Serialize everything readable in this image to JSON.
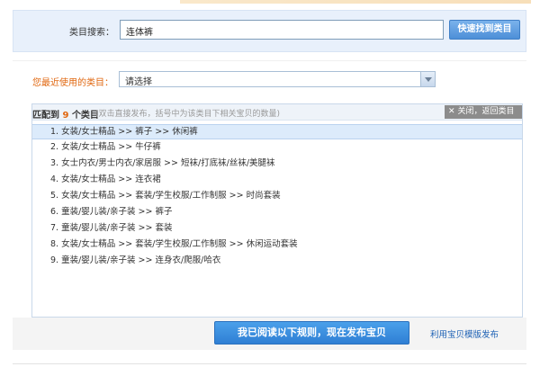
{
  "search": {
    "label": "类目搜索：",
    "value": "连体裤",
    "button_label": "快速找到类目"
  },
  "recent": {
    "label": "您最近使用的类目：",
    "selected": "请选择"
  },
  "results": {
    "title_prefix": "匹配到",
    "count": "9",
    "title_suffix": "个类目",
    "hint": "(双击直接发布，括号中为该类目下相关宝贝的数量)",
    "close_label": "关闭，返回类目",
    "items": [
      {
        "label": "1. 女装/女士精品 >> 裤子 >> 休闲裤"
      },
      {
        "label": "2. 女装/女士精品 >> 牛仔裤"
      },
      {
        "label": "3. 女士内衣/男士内衣/家居服 >> 短袜/打底袜/丝袜/美腿袜"
      },
      {
        "label": "4. 女装/女士精品 >> 连衣裙"
      },
      {
        "label": "5. 女装/女士精品 >> 套装/学生校服/工作制服 >> 时尚套装"
      },
      {
        "label": "6. 童装/婴儿装/亲子装 >> 裤子"
      },
      {
        "label": "7. 童装/婴儿装/亲子装 >> 套装"
      },
      {
        "label": "8. 女装/女士精品 >> 套装/学生校服/工作制服 >> 休闲运动套装"
      },
      {
        "label": "9. 童装/婴儿装/亲子装 >> 连身衣/爬服/哈衣"
      }
    ]
  },
  "footer": {
    "publish_label": "我已阅读以下规则，现在发布宝贝",
    "template_link": "利用宝贝模版发布"
  },
  "colors": {
    "accent_orange": "#e0660e",
    "button_blue": "#3f8ad9",
    "panel_bg": "#e8f0fb",
    "selected_row": "#dcebfb"
  },
  "icons": {
    "close": "close-icon",
    "dropdown": "chevron-down-icon"
  }
}
